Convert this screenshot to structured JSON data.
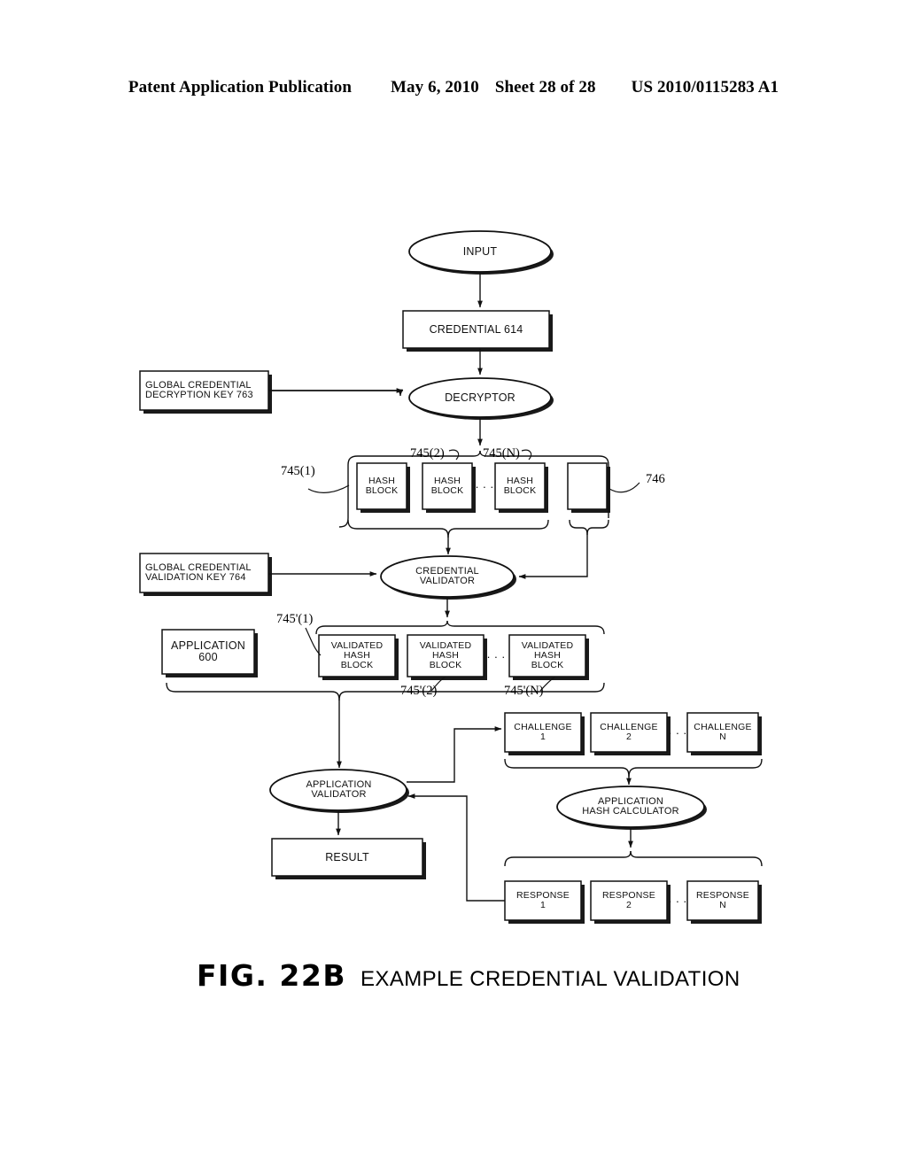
{
  "header": {
    "publication": "Patent Application Publication",
    "date": "May 6, 2010",
    "sheet": "Sheet 28 of 28",
    "number": "US 2010/0115283 A1"
  },
  "figure": {
    "caption_number": "FIG. 22B",
    "caption_title": "EXAMPLE CREDENTIAL VALIDATION",
    "nodes": {
      "input": "INPUT",
      "credential": "CREDENTIAL 614",
      "decryption_key": "GLOBAL CREDENTIAL\nDECRYPTION KEY 763",
      "decryptor": "DECRYPTOR",
      "hash_block_1": "HASH\nBLOCK",
      "hash_block_2": "HASH\nBLOCK",
      "hash_block_n": "HASH\nBLOCK",
      "hash_ellipsis": "· · ·",
      "signature_block": "",
      "validation_key": "GLOBAL CREDENTIAL\nVALIDATION KEY 764",
      "credential_validator": "CREDENTIAL\nVALIDATOR",
      "application": "APPLICATION\n600",
      "validated_hash_block_1": "VALIDATED\nHASH\nBLOCK",
      "validated_hash_block_2": "VALIDATED\nHASH\nBLOCK",
      "validated_hash_block_n": "VALIDATED\nHASH\nBLOCK",
      "validated_ellipsis": "· · ·",
      "challenge_1": "CHALLENGE\n1",
      "challenge_2": "CHALLENGE\n2",
      "challenge_n": "CHALLENGE\nN",
      "challenge_ellipsis": "· · ·",
      "application_validator": "APPLICATION\nVALIDATOR",
      "application_hash_calculator": "APPLICATION\nHASH CALCULATOR",
      "result": "RESULT",
      "response_1": "RESPONSE\n1",
      "response_2": "RESPONSE\n2",
      "response_n": "RESPONSE\nN",
      "response_ellipsis": "· · ·"
    },
    "reference_numerals": {
      "hash_745_1": "745(1)",
      "hash_745_2": "745(2)",
      "hash_745_n": "745(N)",
      "block_746": "746",
      "validated_745_1": "745'(1)",
      "validated_745_2": "745'(2)",
      "validated_745_n": "745'(N)"
    }
  }
}
